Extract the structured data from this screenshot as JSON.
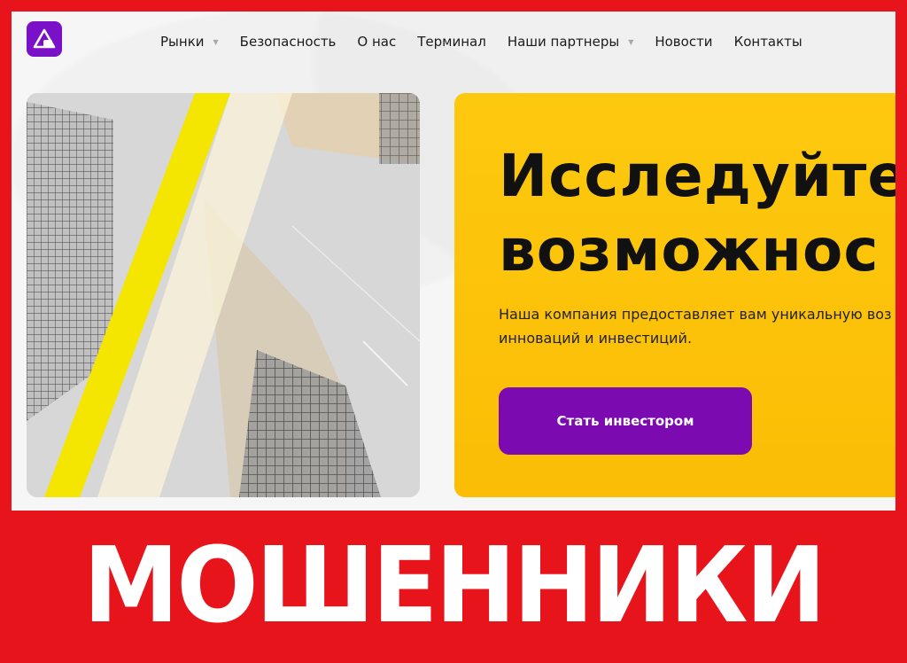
{
  "nav": {
    "items": [
      {
        "label": "Рынки",
        "has_dropdown": true
      },
      {
        "label": "Безопасность",
        "has_dropdown": false
      },
      {
        "label": "О нас",
        "has_dropdown": false
      },
      {
        "label": "Терминал",
        "has_dropdown": false
      },
      {
        "label": "Наши партнеры",
        "has_dropdown": true
      },
      {
        "label": "Новости",
        "has_dropdown": false
      },
      {
        "label": "Контакты",
        "has_dropdown": false
      }
    ]
  },
  "hero": {
    "title_line1": "Исследуйте",
    "title_line2": "возможнос",
    "text_line1": "Наша компания предоставляет вам уникальную воз",
    "text_line2": "инноваций и инвестиций.",
    "cta_label": "Стать инвестором"
  },
  "banner": {
    "text": "МОШЕННИКИ"
  },
  "colors": {
    "frame_red": "#e8141b",
    "brand_purple": "#7a10c7",
    "hero_yellow": "#fdc90f",
    "cta_purple": "#7b0bb1"
  },
  "icons": {
    "logo": "triangle-logo-icon",
    "dropdown": "triangle-down-icon"
  }
}
